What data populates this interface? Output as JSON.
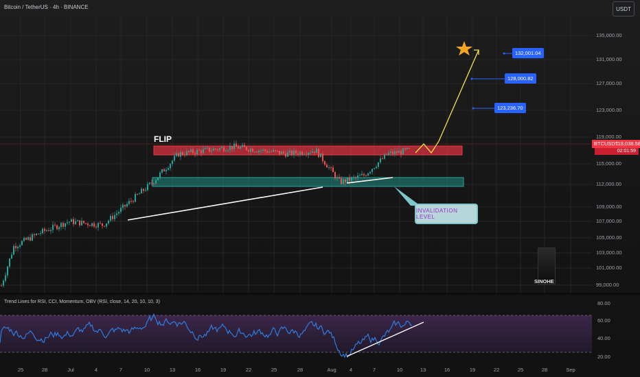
{
  "header": {
    "title": "Bitcoin / TetherUS · 4h · BINANCE",
    "currency_button": "USDT"
  },
  "price_axis": [
    "135,000.00",
    "131,000.00",
    "127,000.00",
    "123,000.00",
    "119,000.00",
    "115,000.00",
    "112,000.00",
    "109,000.00",
    "107,000.00",
    "105,000.00",
    "103,000.00",
    "101,000.00",
    "99,000.00"
  ],
  "date_axis": [
    "25",
    "28",
    "Jul",
    "4",
    "7",
    "10",
    "13",
    "16",
    "19",
    "22",
    "25",
    "28",
    "Aug",
    "4",
    "7",
    "10",
    "13",
    "16",
    "19",
    "22",
    "25",
    "28",
    "Sep"
  ],
  "current_price": {
    "symbol": "BTCUSDT",
    "value": "118,038.58",
    "countdown": "02:01:59",
    "color": "#f23645"
  },
  "targets": [
    "132,001.04",
    "128,000.82",
    "123,236.70"
  ],
  "annotations": {
    "flip": "FLIP",
    "invalidation": "INVALIDATION   LEVEL",
    "author": "SINOHE",
    "star_icon": "star-icon"
  },
  "zones": {
    "resistance_color": "#f23645",
    "support_color": "#26a69a"
  },
  "rsi_panel": {
    "title": "Trend Lines for RSI, CCI, Momentum, OBV (RSI, close, 14, 20, 10, 10, 3)",
    "axis": [
      "80.00",
      "60.00",
      "40.00",
      "20.00"
    ],
    "line_color": "#2f7de1"
  },
  "chart_data": {
    "type": "candlestick",
    "x": [
      "25",
      "28",
      "Jul",
      "4",
      "7",
      "10",
      "13",
      "16",
      "19",
      "22",
      "25",
      "28",
      "Aug",
      "4",
      "7",
      "10"
    ],
    "series": [
      {
        "values": [
          99000,
          104500,
          106500,
          108000,
          107500,
          113500,
          117500,
          118000,
          118500,
          118000,
          117500,
          118000,
          113500,
          114500,
          117500,
          118038.58
        ]
      }
    ],
    "ylim": [
      98000,
      137000
    ],
    "grid": true
  }
}
